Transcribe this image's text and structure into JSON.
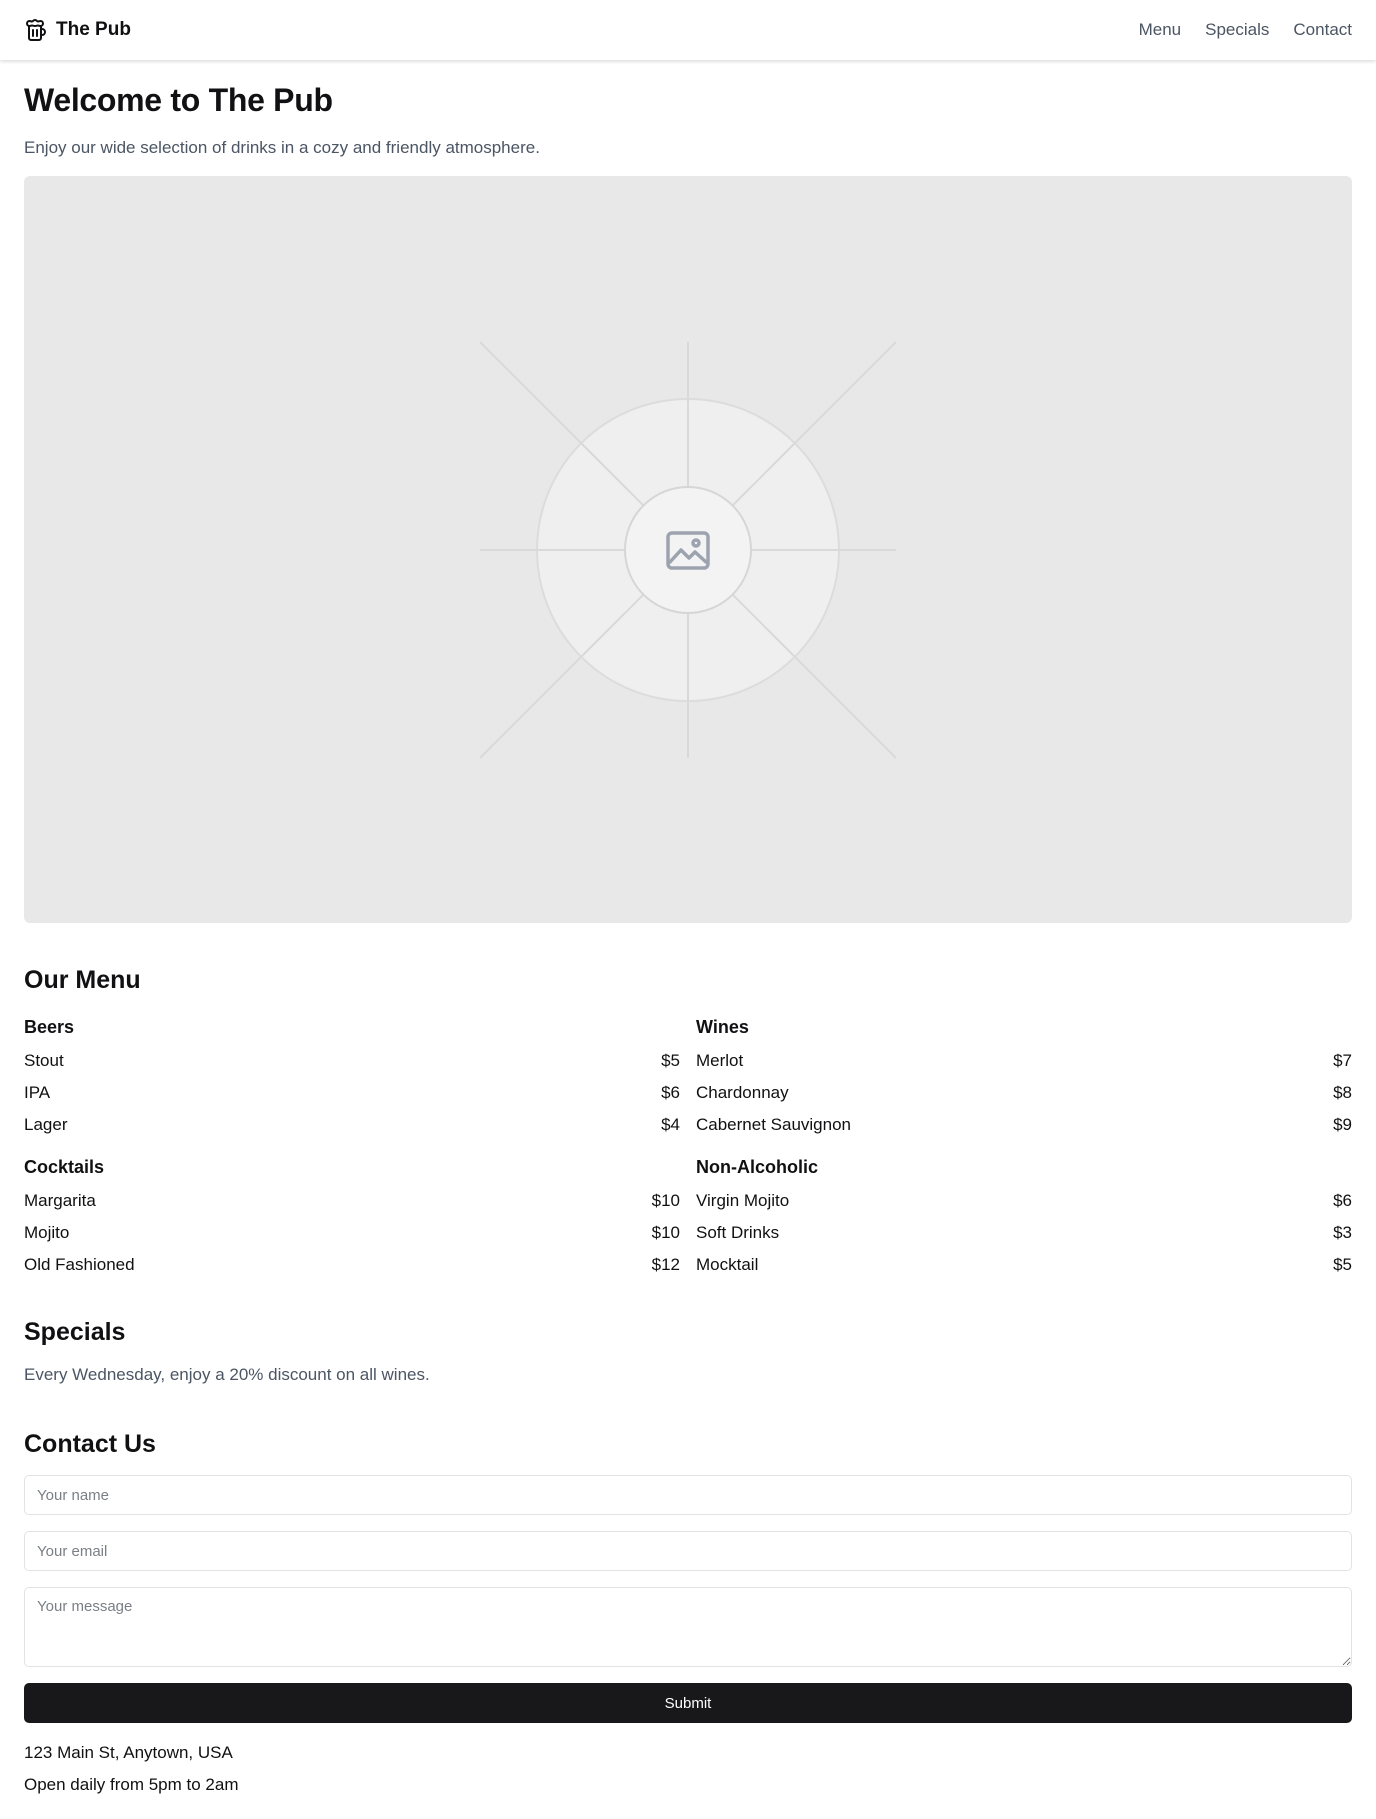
{
  "nav": {
    "brand": "The Pub",
    "brand_icon": "beer-mug-icon",
    "links": [
      "Menu",
      "Specials",
      "Contact"
    ]
  },
  "hero": {
    "title": "Welcome to The Pub",
    "subtitle": "Enjoy our wide selection of drinks in a cozy and friendly atmosphere.",
    "image_icon": "image-placeholder-icon"
  },
  "menu": {
    "title": "Our Menu",
    "categories": [
      {
        "name": "Beers",
        "items": [
          {
            "name": "Stout",
            "price": "$5"
          },
          {
            "name": "IPA",
            "price": "$6"
          },
          {
            "name": "Lager",
            "price": "$4"
          }
        ]
      },
      {
        "name": "Wines",
        "items": [
          {
            "name": "Merlot",
            "price": "$7"
          },
          {
            "name": "Chardonnay",
            "price": "$8"
          },
          {
            "name": "Cabernet Sauvignon",
            "price": "$9"
          }
        ]
      },
      {
        "name": "Cocktails",
        "items": [
          {
            "name": "Margarita",
            "price": "$10"
          },
          {
            "name": "Mojito",
            "price": "$10"
          },
          {
            "name": "Old Fashioned",
            "price": "$12"
          }
        ]
      },
      {
        "name": "Non-Alcoholic",
        "items": [
          {
            "name": "Virgin Mojito",
            "price": "$6"
          },
          {
            "name": "Soft Drinks",
            "price": "$3"
          },
          {
            "name": "Mocktail",
            "price": "$5"
          }
        ]
      }
    ]
  },
  "specials": {
    "title": "Specials",
    "text": "Every Wednesday, enjoy a 20% discount on all wines."
  },
  "contact": {
    "title": "Contact Us",
    "name_placeholder": "Your name",
    "email_placeholder": "Your email",
    "message_placeholder": "Your message",
    "submit_label": "Submit",
    "address": "123 Main St, Anytown, USA",
    "hours": "Open daily from 5pm to 2am"
  },
  "colors": {
    "text": "#111113",
    "muted": "#4b5563",
    "button": "#18181b",
    "placeholder_bg": "#e8e8e8"
  }
}
